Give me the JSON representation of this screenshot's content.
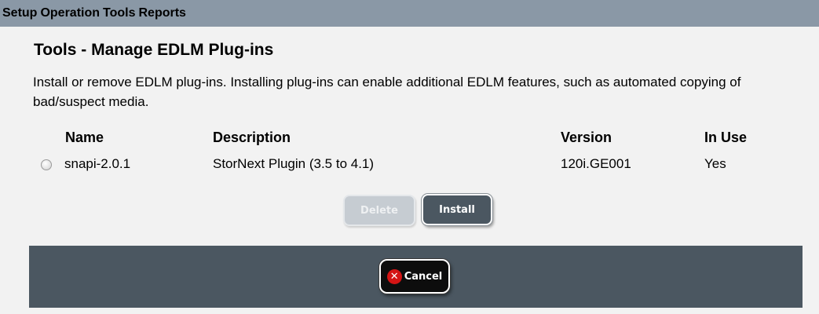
{
  "menubar": {
    "items": [
      "Setup",
      "Operation",
      "Tools",
      "Reports"
    ]
  },
  "page": {
    "title": "Tools - Manage EDLM Plug-ins",
    "description": "Install or remove EDLM plug-ins. Installing plug-ins can enable additional EDLM features, such as automated copying of bad/suspect media."
  },
  "table": {
    "headers": {
      "name": "Name",
      "description": "Description",
      "version": "Version",
      "in_use": "In Use"
    },
    "rows": [
      {
        "selected": false,
        "name": "snapi-2.0.1",
        "description": "StorNext Plugin (3.5 to 4.1)",
        "version": "120i.GE001",
        "in_use": "Yes"
      }
    ]
  },
  "actions": {
    "delete_label": "Delete",
    "install_label": "Install",
    "delete_enabled": false,
    "install_enabled": true
  },
  "footer": {
    "cancel_label": "Cancel",
    "cancel_icon": "x-circle-icon"
  },
  "colors": {
    "menubar_bg": "#8a98a6",
    "panel_bg": "#4b5761",
    "page_bg": "#f2f2f2",
    "cancel_icon": "#d41414"
  }
}
